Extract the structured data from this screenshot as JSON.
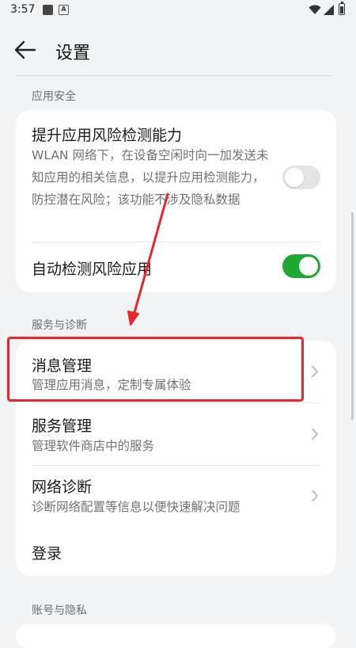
{
  "status_bar": {
    "time": "3:57",
    "a_badge": "A"
  },
  "header": {
    "title": "设置"
  },
  "sections": {
    "app_security": {
      "title": "应用安全",
      "items": [
        {
          "title": "提升应用风险检测能力",
          "description": "WLAN 网络下，在设备空闲时向一加发送未知应用的相关信息，以提升应用检测能力，防控潜在风险；该功能不涉及隐私数据",
          "switch_on": false
        },
        {
          "title": "自动检测风险应用",
          "switch_on": true
        }
      ]
    },
    "service_diagnostics": {
      "title": "服务与诊断",
      "items": [
        {
          "title": "消息管理",
          "description": "管理应用消息，定制专属体验"
        },
        {
          "title": "服务管理",
          "description": "管理软件商店中的服务"
        },
        {
          "title": "网络诊断",
          "description": "诊断网络配置等信息以便快速解决问题"
        },
        {
          "title": "登录"
        }
      ]
    },
    "account_privacy": {
      "title": "账号与隐私"
    }
  },
  "colors": {
    "switch_on": "#1fa733",
    "switch_off": "#e3e4e6",
    "annotation_red": "#e8262b"
  }
}
